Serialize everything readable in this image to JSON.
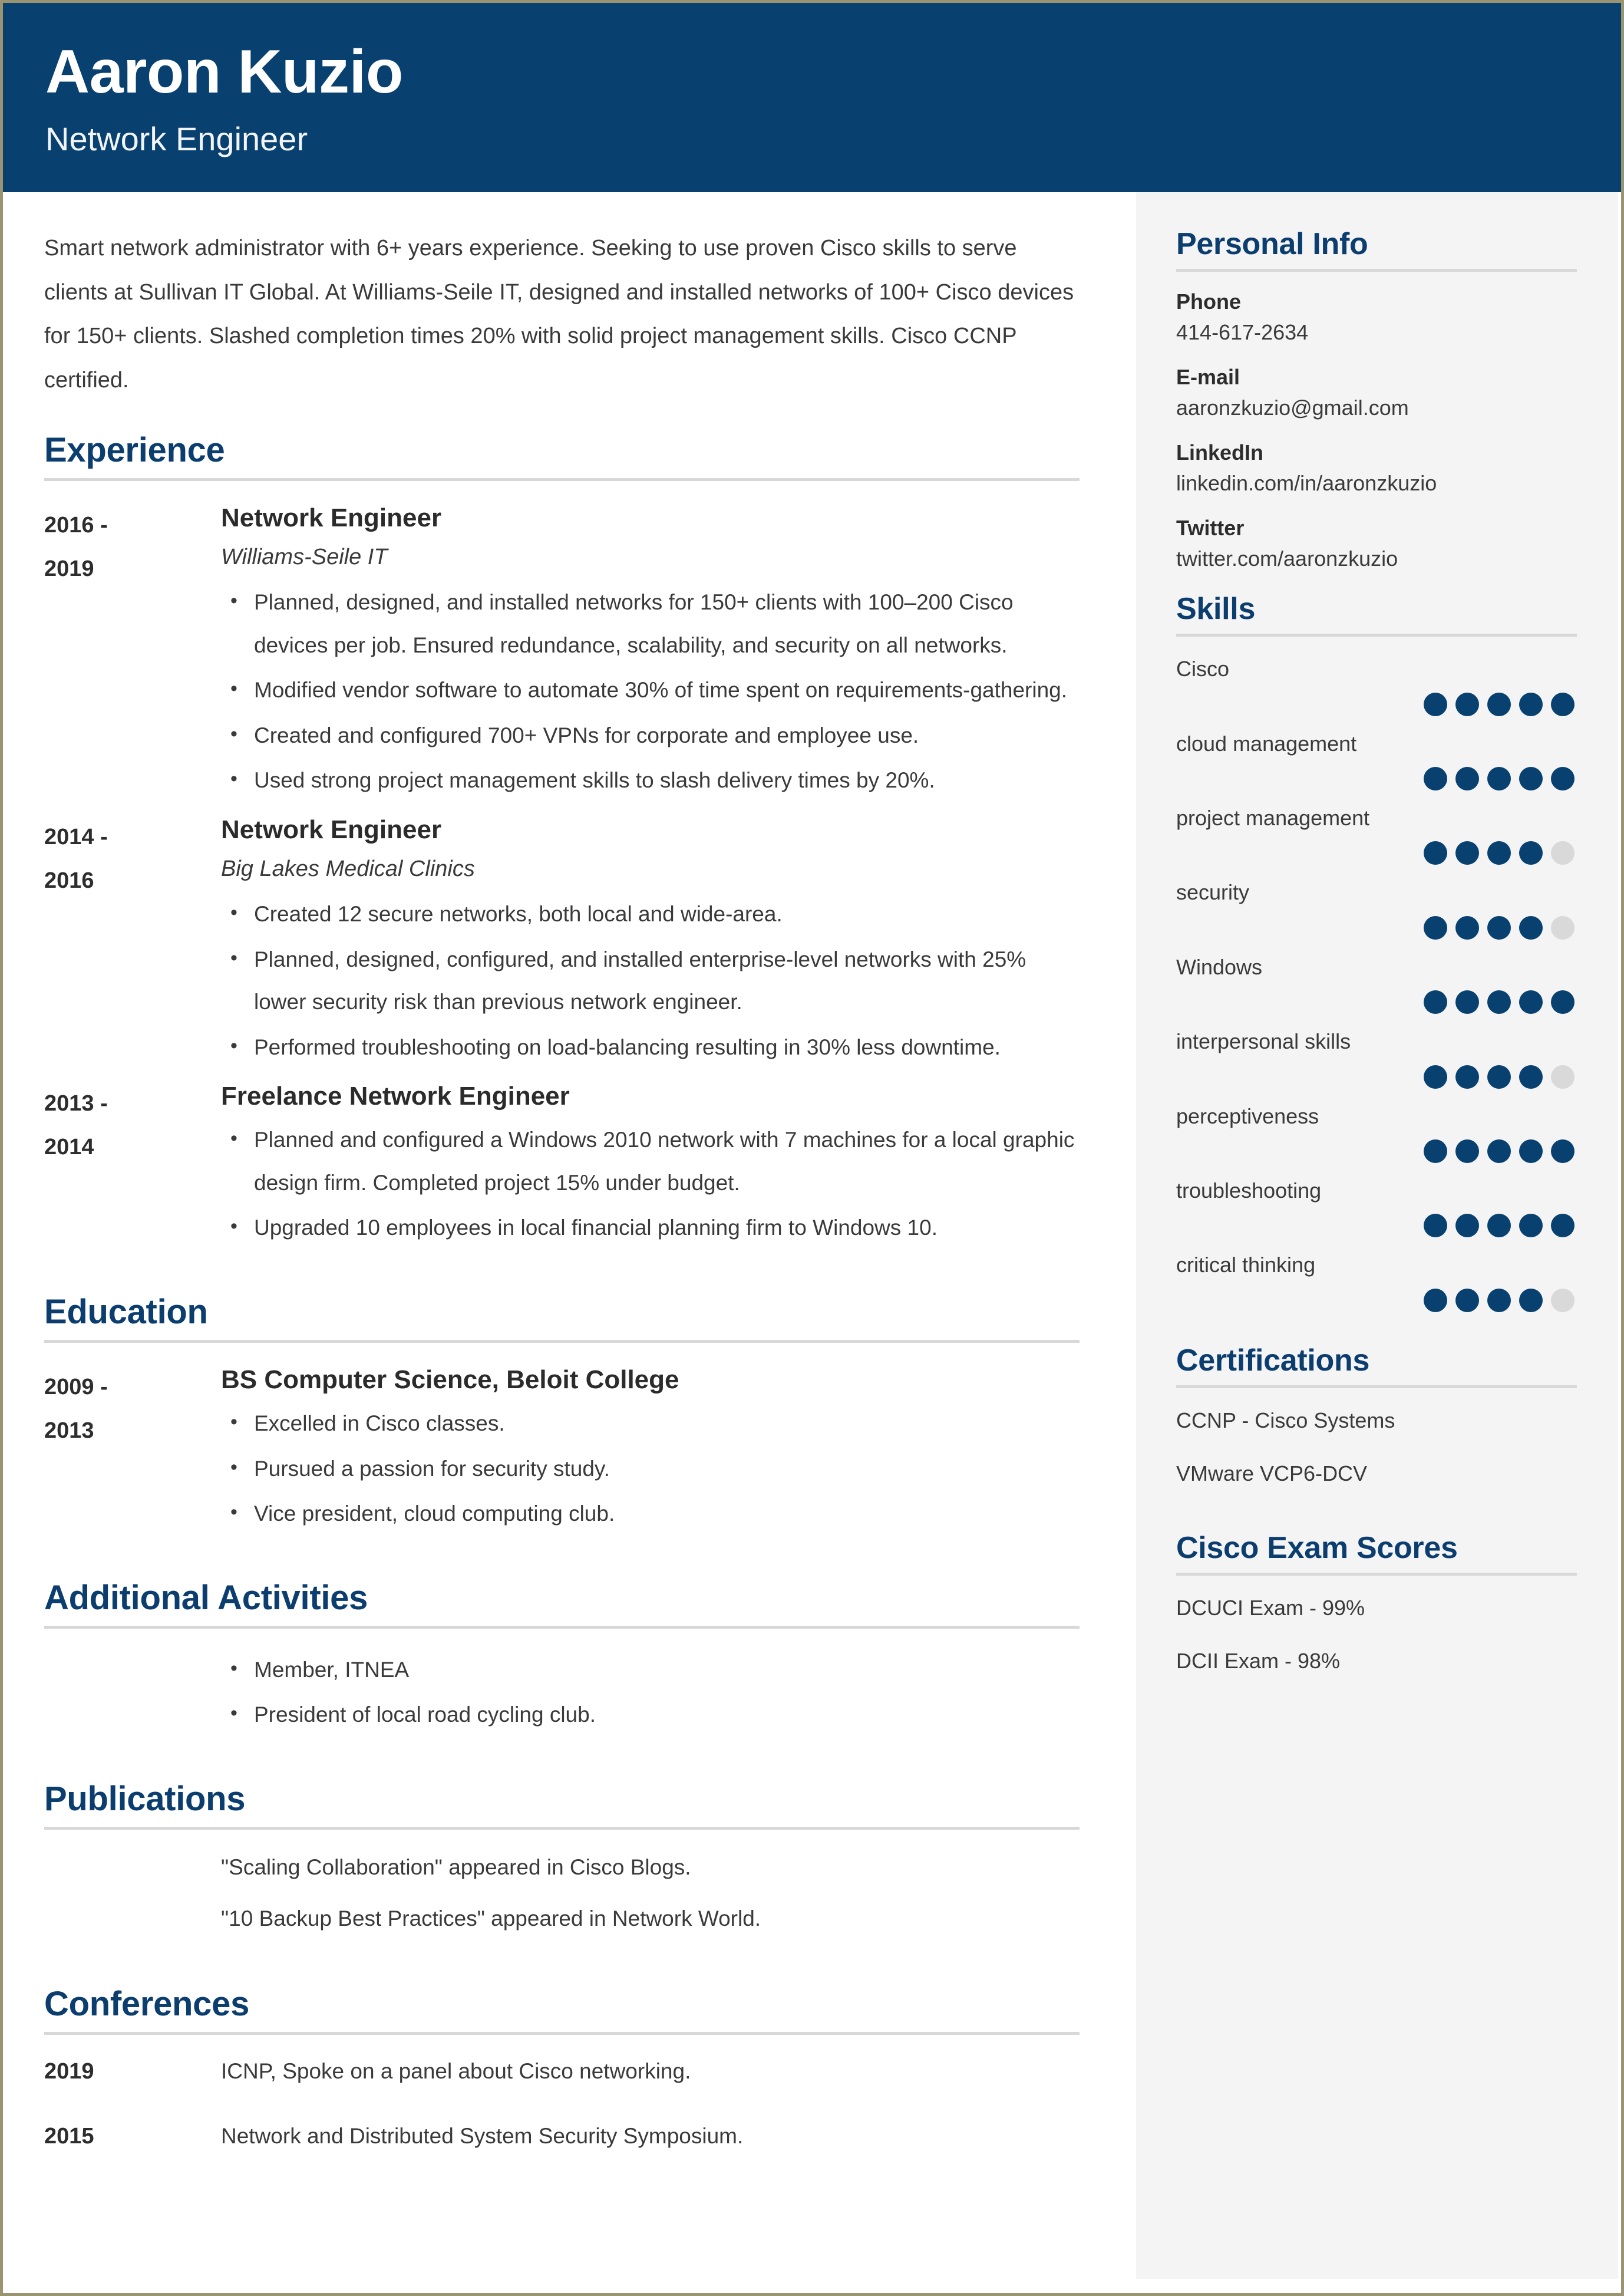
{
  "theme": {
    "header_blue": "#08406f",
    "heading_blue": "#0b3d6e",
    "sidebar_bg": "#f4f4f4",
    "rule_gray": "#d8d8d8",
    "dot_off": "#d9d9d9",
    "page_border": "#9a9472"
  },
  "header": {
    "name": "Aaron Kuzio",
    "role": "Network Engineer"
  },
  "summary": "Smart network administrator with 6+ years experience. Seeking to use proven Cisco skills to serve clients at Sullivan IT Global. At Williams-Seile IT, designed and installed networks of 100+ Cisco devices for 150+ clients. Slashed completion times 20% with solid project management skills. Cisco CCNP certified.",
  "sections": {
    "experience_title": "Experience",
    "education_title": "Education",
    "activities_title": "Additional Activities",
    "publications_title": "Publications",
    "conferences_title": "Conferences"
  },
  "experience": [
    {
      "date_start": "2016 -",
      "date_end": "2019",
      "job_title": "Network Engineer",
      "company": "Williams-Seile IT",
      "bullets": [
        "Planned, designed, and installed networks for 150+ clients with 100–200 Cisco devices per job. Ensured redundance, scalability, and security on all networks.",
        "Modified vendor software to automate 30% of time spent on requirements-gathering.",
        "Created and configured 700+ VPNs for corporate and employee use.",
        "Used strong project management skills to slash delivery times by 20%."
      ]
    },
    {
      "date_start": "2014 -",
      "date_end": "2016",
      "job_title": "Network Engineer",
      "company": "Big Lakes Medical Clinics",
      "bullets": [
        "Created 12 secure networks, both local and wide-area.",
        "Planned, designed, configured, and installed enterprise-level networks with 25% lower security risk than previous network engineer.",
        "Performed troubleshooting on load-balancing resulting in 30% less downtime."
      ]
    },
    {
      "date_start": "2013 -",
      "date_end": "2014",
      "job_title": "Freelance Network Engineer",
      "company": "",
      "bullets": [
        "Planned and configured a Windows 2010 network with 7 machines for a local graphic design firm. Completed project 15% under budget.",
        "Upgraded 10 employees in local financial planning firm to Windows 10."
      ]
    }
  ],
  "education": [
    {
      "date_start": "2009 -",
      "date_end": "2013",
      "degree": "BS Computer Science, Beloit College",
      "bullets": [
        "Excelled in Cisco classes.",
        "Pursued a passion for security study.",
        "Vice president, cloud computing club."
      ]
    }
  ],
  "activities": [
    "Member, ITNEA",
    "President of local road cycling club."
  ],
  "publications": [
    "\"Scaling Collaboration\" appeared in Cisco Blogs.",
    "\"10 Backup Best Practices\" appeared in Network World."
  ],
  "conferences": [
    {
      "year": "2019",
      "text": "ICNP, Spoke on a panel about Cisco networking."
    },
    {
      "year": "2015",
      "text": "Network and Distributed System Security Symposium."
    }
  ],
  "sidebar": {
    "personal_info_title": "Personal Info",
    "contacts": [
      {
        "label": "Phone",
        "value": "414-617-2634"
      },
      {
        "label": "E-mail",
        "value": "aaronzkuzio@gmail.com"
      },
      {
        "label": "LinkedIn",
        "value": "linkedin.com/in/aaronzkuzio"
      },
      {
        "label": "Twitter",
        "value": "twitter.com/aaronzkuzio"
      }
    ],
    "skills_title": "Skills",
    "skills_max": 5,
    "skills": [
      {
        "name": "Cisco",
        "rating": 5
      },
      {
        "name": "cloud management",
        "rating": 5
      },
      {
        "name": "project management",
        "rating": 4
      },
      {
        "name": "security",
        "rating": 4
      },
      {
        "name": "Windows",
        "rating": 5
      },
      {
        "name": "interpersonal skills",
        "rating": 4
      },
      {
        "name": "perceptiveness",
        "rating": 5
      },
      {
        "name": "troubleshooting",
        "rating": 5
      },
      {
        "name": "critical thinking",
        "rating": 4
      }
    ],
    "certifications_title": "Certifications",
    "certifications": [
      "CCNP - Cisco Systems",
      "VMware VCP6-DCV"
    ],
    "exam_scores_title": "Cisco Exam Scores",
    "exam_scores": [
      "DCUCI Exam - 99%",
      "DCII Exam - 98%"
    ]
  }
}
